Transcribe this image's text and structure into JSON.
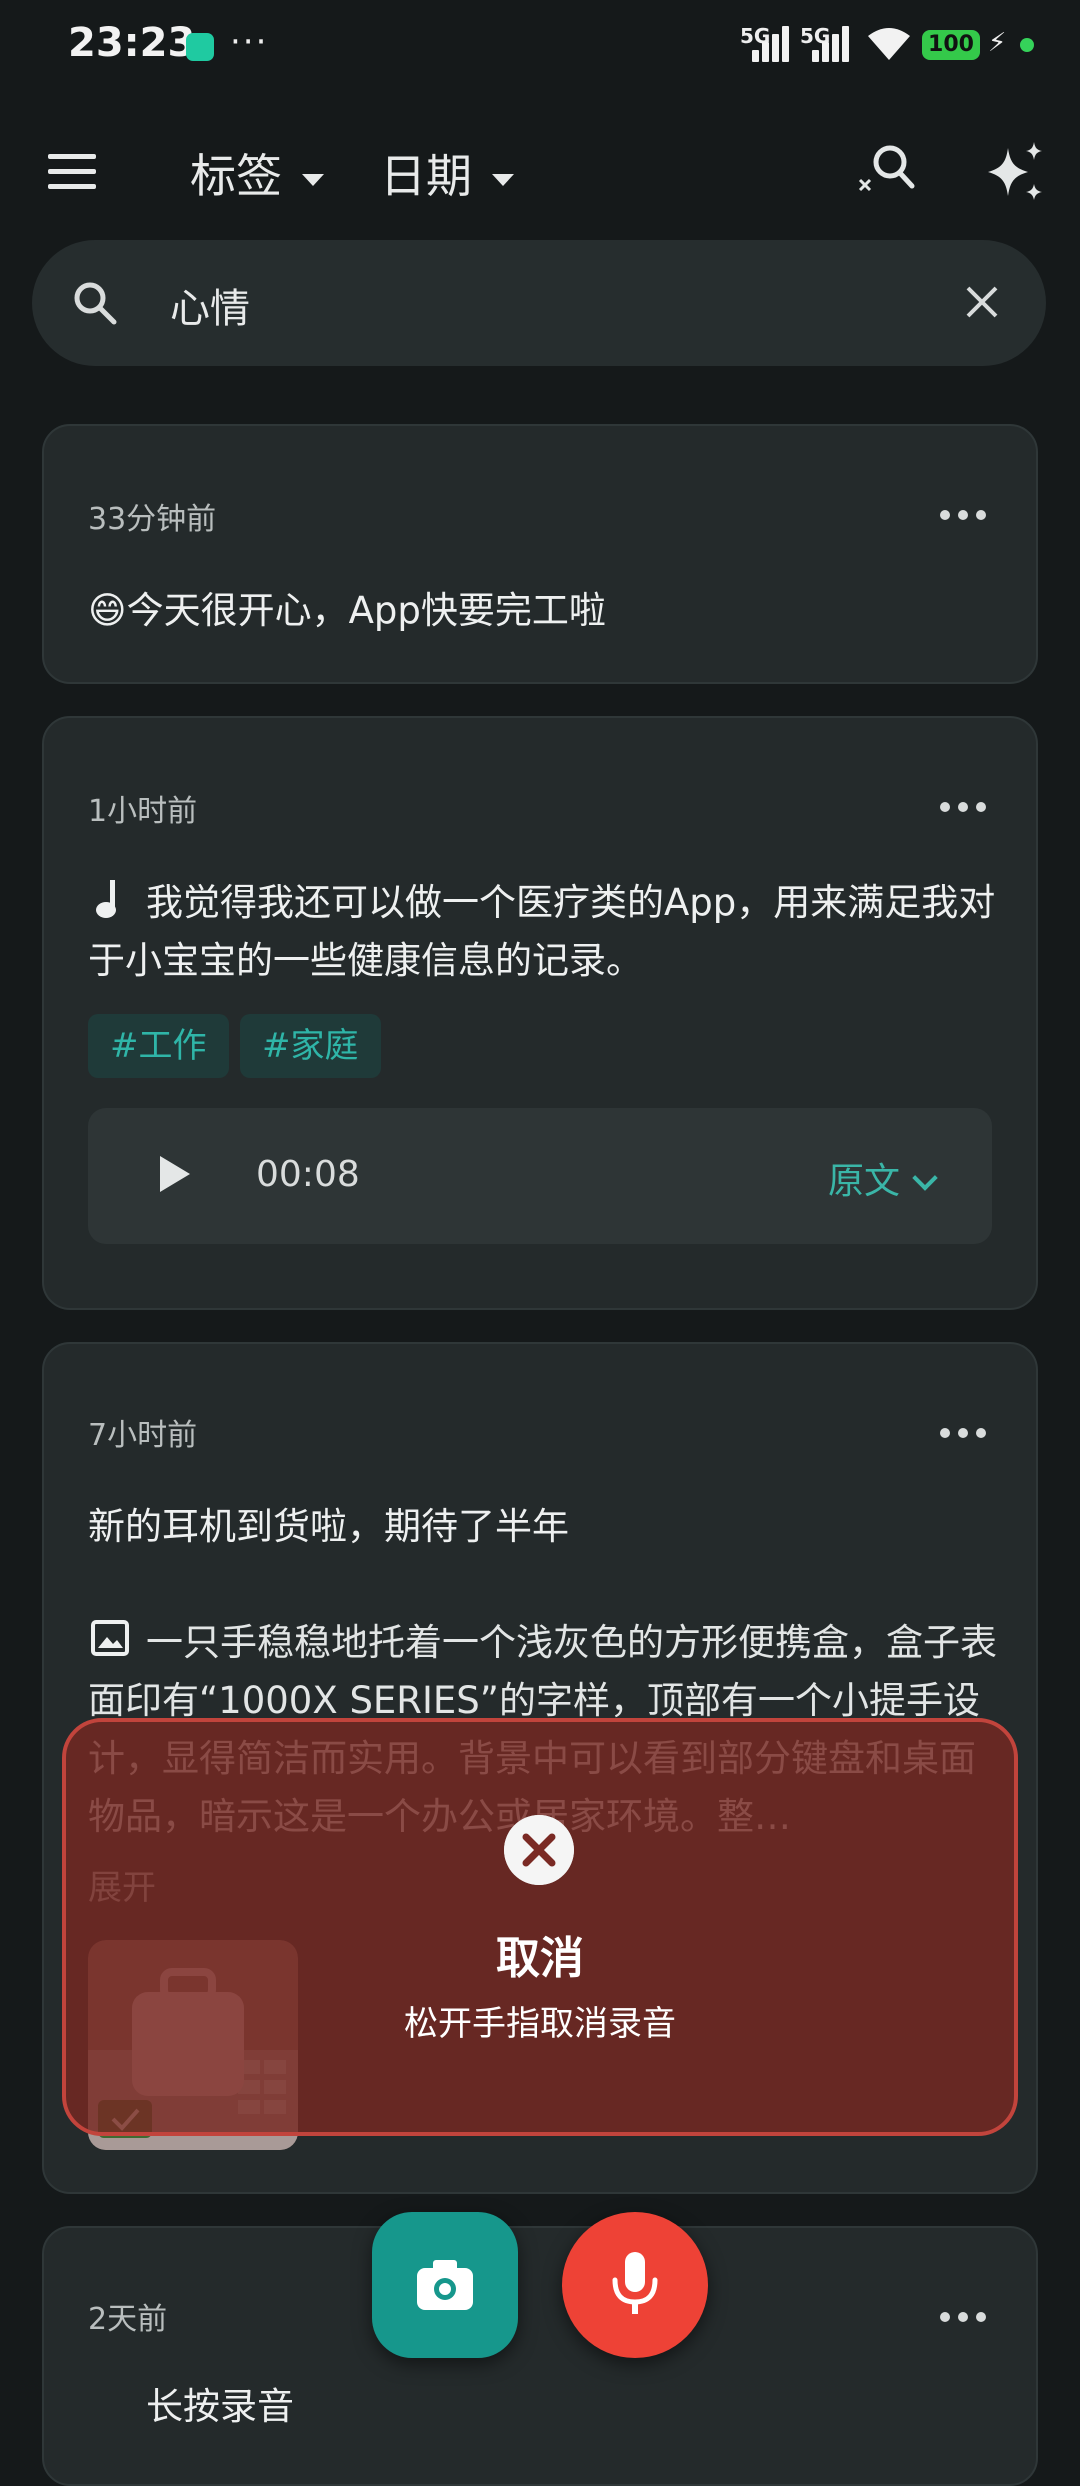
{
  "status_bar": {
    "time": "23:23",
    "more": "···",
    "sim1": "5G",
    "sim2": "5G",
    "battery": "100",
    "charging": "⚡"
  },
  "toolbar": {
    "tag_filter": "标签",
    "date_filter": "日期",
    "icons": [
      "menu-icon",
      "search-ai-icon",
      "sparkle-icon"
    ]
  },
  "search": {
    "query": "心情"
  },
  "notes": [
    {
      "time": "33分钟前",
      "text": "😄今天很开心，App快要完工啦"
    },
    {
      "time": "1小时前",
      "text": "我觉得我还可以做一个医疗类的App，用来满足我对于小宝宝的一些健康信息的记录。",
      "tags": [
        "#工作",
        "#家庭"
      ],
      "audio": {
        "duration": "00:08",
        "original_label": "原文"
      }
    },
    {
      "time": "7小时前",
      "text": "新的耳机到货啦，期待了半年",
      "image_desc": "一只手稳稳地托着一个浅灰色的方形便携盒，盒子表面印有“1000X SERIES”的字样，顶部有一个小提手设计，显得简洁而实用。背景中可以看到部分键盘和桌面物品，暗示这是一个办公或居家环境。整…",
      "expand": "展开"
    },
    {
      "time": "2天前",
      "text": "长按录音"
    }
  ],
  "cancel_overlay": {
    "title": "取消",
    "hint": "松开手指取消录音"
  },
  "colors": {
    "background": "#15191a",
    "card": "#242a2b",
    "accent": "#16978c",
    "record": "#ee4236",
    "cancel": "#c2443c"
  }
}
